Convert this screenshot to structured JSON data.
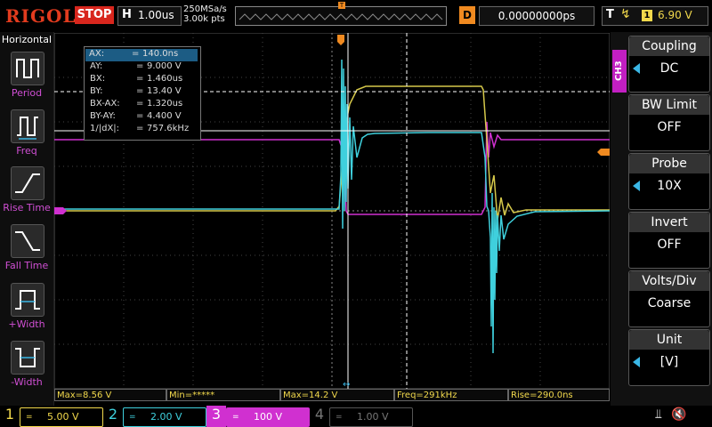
{
  "brand": "RIGOL",
  "run_state": "STOP",
  "horizontal": {
    "key": "H",
    "timebase": "1.00us"
  },
  "acquisition": {
    "sample_rate": "250MSa/s",
    "points": "3.00k pts"
  },
  "trigger_marker": "T",
  "delay": {
    "key": "D",
    "value": "0.00000000ps"
  },
  "trigger": {
    "key": "T",
    "edge_icon": "rising-edge-icon",
    "source": "1",
    "level": "6.90 V"
  },
  "left_menu": {
    "title": "Horizontal",
    "items": [
      {
        "label": "Period",
        "icon": "period-icon"
      },
      {
        "label": "Freq",
        "icon": "freq-icon"
      },
      {
        "label": "Rise Time",
        "icon": "rise-time-icon"
      },
      {
        "label": "Fall Time",
        "icon": "fall-time-icon"
      },
      {
        "label": "+Width",
        "icon": "pos-width-icon"
      },
      {
        "label": "-Width",
        "icon": "neg-width-icon"
      }
    ]
  },
  "cursor_readout": [
    {
      "label": "AX:",
      "value": "140.0ns"
    },
    {
      "label": "AY:",
      "value": "9.000 V"
    },
    {
      "label": "BX:",
      "value": "1.460us"
    },
    {
      "label": "BY:",
      "value": "13.40 V"
    },
    {
      "label": "BX-AX:",
      "value": "1.320us"
    },
    {
      "label": "BY-AY:",
      "value": "4.400 V"
    },
    {
      "label": "1/|dX|:",
      "value": "757.6kHz"
    }
  ],
  "right_panel": {
    "channel_tab": "CH3",
    "buttons": [
      {
        "title": "Coupling",
        "value": "DC",
        "has_arrow": true
      },
      {
        "title": "BW Limit",
        "value": "OFF",
        "has_arrow": false
      },
      {
        "title": "Probe",
        "value": "10X",
        "has_arrow": true
      },
      {
        "title": "Invert",
        "value": "OFF",
        "has_arrow": false
      },
      {
        "title": "Volts/Div",
        "value": "Coarse",
        "has_arrow": false
      },
      {
        "title": "Unit",
        "value": "[V]",
        "has_arrow": true
      }
    ]
  },
  "measurements": [
    "Max=8.56 V",
    "Min=*****",
    "Max=14.2 V",
    "Freq=291kHz",
    "Rise=290.0ns"
  ],
  "channels": [
    {
      "num": "1",
      "coupling": "=",
      "scale": "5.00 V",
      "color": "#f2d94c",
      "active": false
    },
    {
      "num": "2",
      "coupling": "=",
      "scale": "2.00 V",
      "color": "#3fd0dd",
      "active": false
    },
    {
      "num": "3",
      "coupling": "=",
      "scale": "100 V",
      "color": "#d030d0",
      "active": true
    },
    {
      "num": "4",
      "coupling": "=",
      "scale": "1.00 V",
      "color": "#777777",
      "active": false
    }
  ],
  "status_icons": [
    "usb-icon",
    "speaker-muted-icon"
  ],
  "colors": {
    "ch1": "#f2d94c",
    "ch2": "#3fd0dd",
    "ch3": "#d030d0",
    "ch4": "#777777",
    "trigger": "#f08a20",
    "accent": "#3ab7e6"
  }
}
